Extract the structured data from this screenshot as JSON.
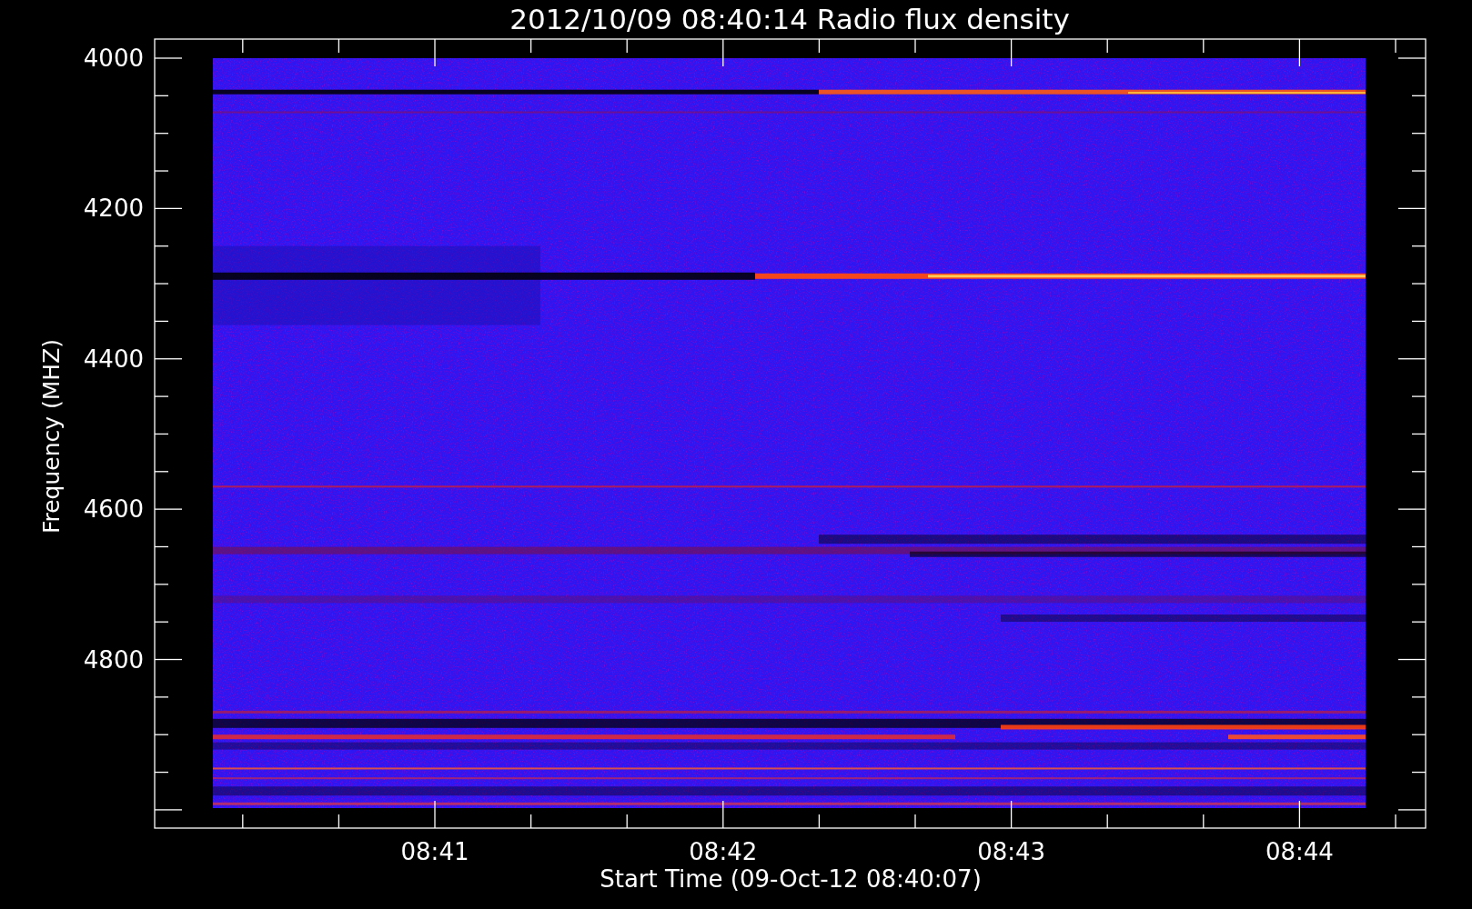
{
  "title": "2012/10/09 08:40:14 Radio flux density",
  "y_axis": {
    "label": "Frequency (MHZ)",
    "ticks": [
      "4000",
      "4200",
      "4400",
      "4600",
      "4800"
    ]
  },
  "x_axis": {
    "label": "Start Time (09-Oct-12 08:40:07)",
    "ticks": [
      "08:41",
      "08:42",
      "08:43",
      "08:44"
    ]
  }
}
